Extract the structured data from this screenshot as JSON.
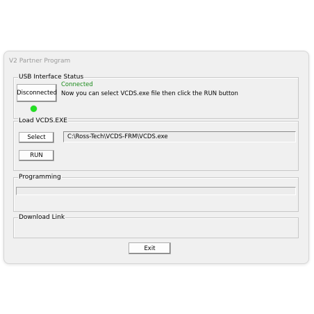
{
  "window": {
    "title": "V2 Partner Program"
  },
  "usb": {
    "legend": "USB Interface Status",
    "disconnect_button": "Disconnected",
    "status_text": "Connected",
    "message": "Now you can select VCDS.exe file then click the RUN button",
    "led_color": "#22e022"
  },
  "load": {
    "legend": "Load VCDS.EXE",
    "select_button": "Select",
    "path_value": "C:\\Ross-Tech\\VCDS-FRM\\VCDS.exe",
    "run_button": "RUN"
  },
  "programming": {
    "legend": "Programming",
    "progress": 0
  },
  "download": {
    "legend": "Download Link"
  },
  "footer": {
    "exit_button": "Exit"
  }
}
